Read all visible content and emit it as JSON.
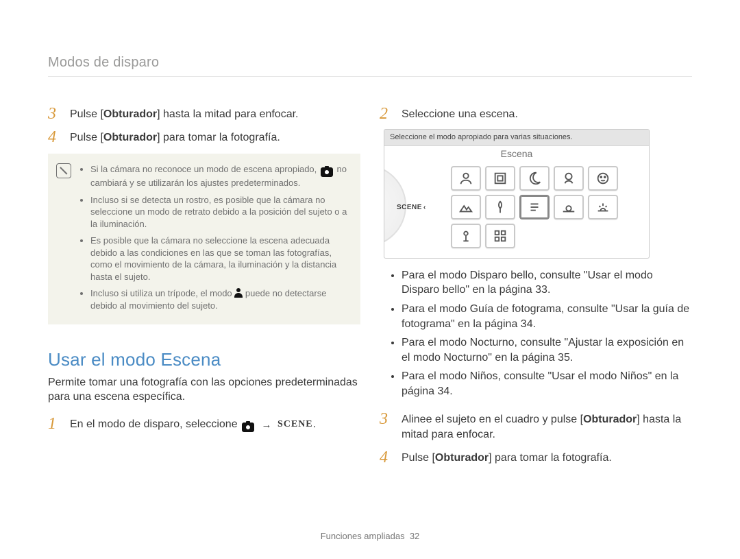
{
  "breadcrumb": "Modos de disparo",
  "left_steps": [
    {
      "n": "3",
      "pre": "Pulse [",
      "bold": "Obturador",
      "post": "] hasta la mitad para enfocar."
    },
    {
      "n": "4",
      "pre": "Pulse [",
      "bold": "Obturador",
      "post": "] para tomar la fotografía."
    }
  ],
  "note_items": [
    {
      "pre": "Si la cámara no reconoce un modo de escena apropiado, ",
      "icon": "camera-smart",
      "post": " no cambiará y se utilizarán los ajustes predeterminados."
    },
    {
      "pre": "Incluso si se detecta un rostro, es posible que la cámara no seleccione un modo de retrato debido a la posición del sujeto o a la iluminación.",
      "icon": "",
      "post": ""
    },
    {
      "pre": "Es posible que la cámara no seleccione la escena adecuada debido a las condiciones en las que se toman las fotografías, como el movimiento de la cámara, la iluminación y la distancia hasta el sujeto.",
      "icon": "",
      "post": ""
    },
    {
      "pre": "Incluso si utiliza un trípode, el modo ",
      "icon": "person",
      "post": " puede no detectarse debido al movimiento del sujeto."
    }
  ],
  "section_heading": "Usar el modo Escena",
  "section_sub": "Permite tomar una fotografía con las opciones predeterminadas para una escena específica.",
  "left_step_scene": {
    "n": "1",
    "text": "En el modo de disparo, seleccione",
    "arrow": "→",
    "suffix": "."
  },
  "right_first_step": {
    "n": "2",
    "text": "Seleccione una escena."
  },
  "scene_panel": {
    "banner": "Seleccione el modo apropiado para varias situaciones.",
    "title": "Escena",
    "dial_label": "SCENE",
    "tiles": [
      "portrait",
      "frame",
      "night",
      "kids",
      "face",
      "landscape",
      "macro",
      "text",
      "sunset",
      "dawn",
      "backlight",
      "grid5"
    ],
    "selected_index": 7
  },
  "refs": [
    "Para el modo Disparo bello, consulte \"Usar el modo Disparo bello\" en la página 33.",
    "Para el modo Guía de fotograma, consulte \"Usar la guía de fotograma\" en la página 34.",
    "Para el modo Nocturno, consulte \"Ajustar la exposición en el modo Nocturno\" en la página 35.",
    "Para el modo Niños, consulte \"Usar el modo Niños\" en la página 34."
  ],
  "right_steps_bottom": [
    {
      "n": "3",
      "pre": "Alinee el sujeto en el cuadro y pulse [",
      "bold": "Obturador",
      "post": "] hasta la mitad para enfocar."
    },
    {
      "n": "4",
      "pre": "Pulse [",
      "bold": "Obturador",
      "post": "] para tomar la fotografía."
    }
  ],
  "footer": {
    "label": "Funciones ampliadas",
    "page": "32"
  }
}
